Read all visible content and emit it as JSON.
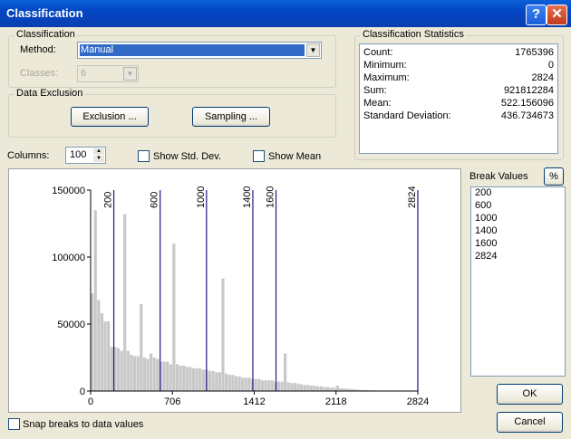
{
  "window": {
    "title": "Classification",
    "help_label": "?",
    "close_label": "✕"
  },
  "classification": {
    "group_label": "Classification",
    "method_label": "Method:",
    "method_value": "Manual",
    "classes_label": "Classes:",
    "classes_value": "6"
  },
  "data_exclusion": {
    "group_label": "Data Exclusion",
    "exclusion_button": "Exclusion ...",
    "sampling_button": "Sampling ..."
  },
  "statistics": {
    "group_label": "Classification Statistics",
    "rows": [
      {
        "label": "Count:",
        "value": "1765396"
      },
      {
        "label": "Minimum:",
        "value": "0"
      },
      {
        "label": "Maximum:",
        "value": "2824"
      },
      {
        "label": "Sum:",
        "value": "921812284"
      },
      {
        "label": "Mean:",
        "value": "522.156096"
      },
      {
        "label": "Standard Deviation:",
        "value": "436.734673"
      }
    ]
  },
  "columns": {
    "label": "Columns:",
    "value": "100"
  },
  "options": {
    "show_std_dev": "Show Std. Dev.",
    "show_mean": "Show Mean",
    "snap_breaks": "Snap breaks to data values"
  },
  "break_values": {
    "label": "Break Values",
    "percent_button": "%",
    "items": [
      "200",
      "600",
      "1000",
      "1400",
      "1600",
      "2824"
    ]
  },
  "buttons": {
    "ok": "OK",
    "cancel": "Cancel"
  },
  "colors": {
    "bars": "#c8c8c8",
    "break_lines": "#1a1a8c"
  },
  "chart_data": {
    "type": "bar",
    "x_ticks": [
      "0",
      "706",
      "1412",
      "2118",
      "2824"
    ],
    "y_ticks": [
      "0",
      "50000",
      "100000",
      "150000"
    ],
    "xlim": [
      0,
      2824
    ],
    "ylim": [
      0,
      150000
    ],
    "breaks": [
      200,
      600,
      1000,
      1400,
      1600,
      2824
    ],
    "break_labels": [
      "200",
      "600",
      "1000",
      "1400",
      "1600",
      "2824"
    ],
    "bin_width": 28.24,
    "values": [
      73000,
      135000,
      68000,
      58000,
      52000,
      52000,
      33000,
      33000,
      32000,
      30000,
      132000,
      30000,
      27000,
      26000,
      26000,
      65000,
      25000,
      24000,
      28000,
      25000,
      24000,
      22000,
      22000,
      22000,
      20000,
      110000,
      20000,
      19000,
      19000,
      18000,
      18000,
      17000,
      17000,
      17000,
      16000,
      16000,
      15000,
      15000,
      14000,
      14000,
      84000,
      13000,
      12000,
      12000,
      11000,
      11000,
      10000,
      10000,
      10000,
      9000,
      9000,
      9000,
      8000,
      8000,
      8000,
      8000,
      7000,
      7000,
      7000,
      28000,
      6500,
      6000,
      6000,
      5500,
      5000,
      4500,
      4500,
      4000,
      4000,
      3500,
      3500,
      3000,
      3000,
      2500,
      2500,
      4000,
      2000,
      2000,
      1800,
      1500,
      1300,
      1100,
      900,
      800,
      700,
      600,
      500,
      400,
      300,
      300,
      250,
      200,
      150,
      120,
      100,
      80,
      60,
      50,
      40,
      30
    ]
  }
}
